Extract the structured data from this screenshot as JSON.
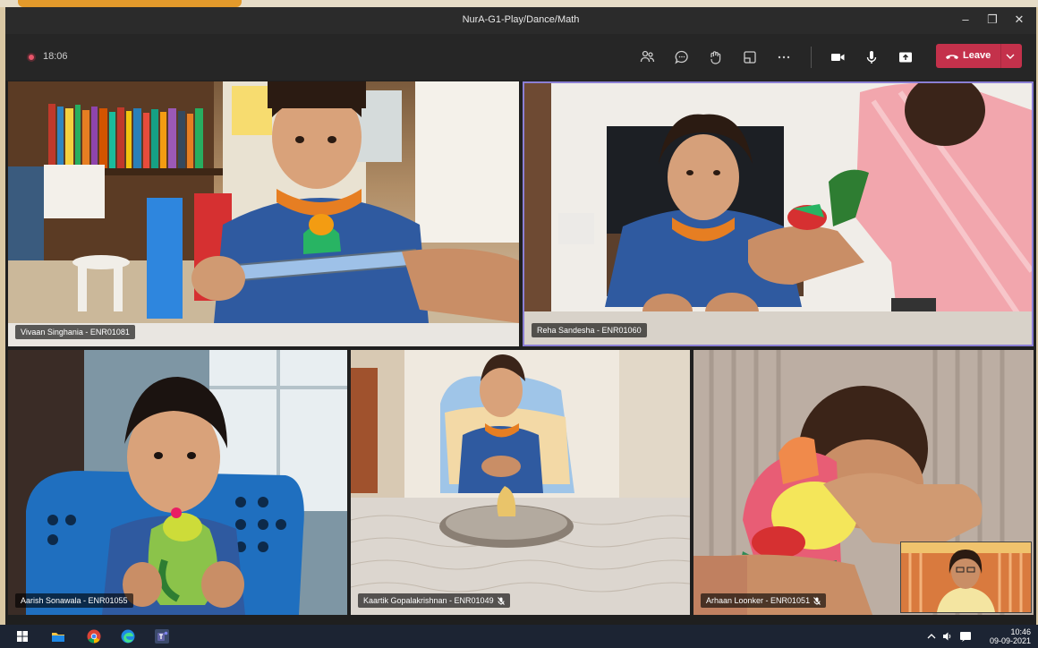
{
  "app": {
    "window_title": "NurA-G1-Play/Dance/Math"
  },
  "toolbar": {
    "elapsed": "18:06",
    "leave_label": "Leave"
  },
  "participants": [
    {
      "name": "Vivaan Singhania - ENR01081"
    },
    {
      "name": "Reha Sandesha - ENR01060"
    },
    {
      "name": "Aarish Sonawala - ENR01055"
    },
    {
      "name": "Kaartik Gopalakrishnan - ENR01049"
    },
    {
      "name": "Arhaan Loonker - ENR01051"
    }
  ],
  "taskbar": {
    "time": "10:46",
    "date": "09-09-2021"
  },
  "colors": {
    "leave": "#c4314b",
    "recording": "#e7556a",
    "active_speaker": "#8b7fd4"
  }
}
